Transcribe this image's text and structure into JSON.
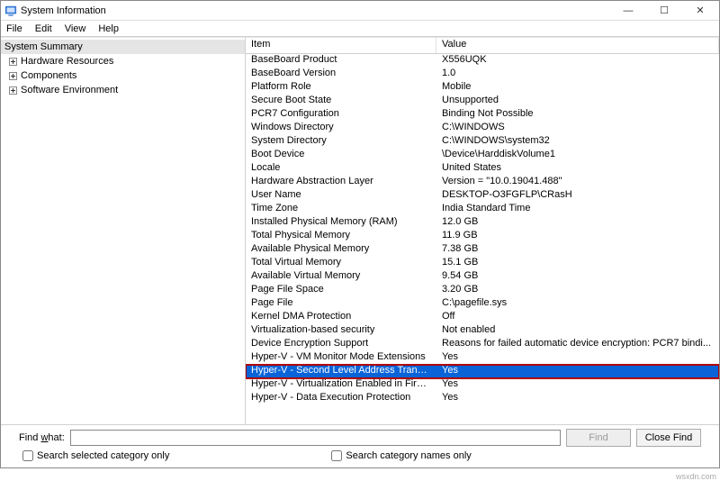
{
  "window": {
    "title": "System Information",
    "controls": {
      "minimize": "—",
      "maximize": "☐",
      "close": "✕"
    }
  },
  "menu": {
    "file": "File",
    "edit": "Edit",
    "view": "View",
    "help": "Help"
  },
  "tree": {
    "root": "System Summary",
    "children": [
      {
        "label": "Hardware Resources"
      },
      {
        "label": "Components"
      },
      {
        "label": "Software Environment"
      }
    ]
  },
  "grid": {
    "headers": {
      "item": "Item",
      "value": "Value"
    },
    "rows": [
      {
        "item": "BaseBoard Product",
        "value": "X556UQK"
      },
      {
        "item": "BaseBoard Version",
        "value": "1.0"
      },
      {
        "item": "Platform Role",
        "value": "Mobile"
      },
      {
        "item": "Secure Boot State",
        "value": "Unsupported"
      },
      {
        "item": "PCR7 Configuration",
        "value": "Binding Not Possible"
      },
      {
        "item": "Windows Directory",
        "value": "C:\\WINDOWS"
      },
      {
        "item": "System Directory",
        "value": "C:\\WINDOWS\\system32"
      },
      {
        "item": "Boot Device",
        "value": "\\Device\\HarddiskVolume1"
      },
      {
        "item": "Locale",
        "value": "United States"
      },
      {
        "item": "Hardware Abstraction Layer",
        "value": "Version = \"10.0.19041.488\""
      },
      {
        "item": "User Name",
        "value": "DESKTOP-O3FGFLP\\CRasH"
      },
      {
        "item": "Time Zone",
        "value": "India Standard Time"
      },
      {
        "item": "Installed Physical Memory (RAM)",
        "value": "12.0 GB"
      },
      {
        "item": "Total Physical Memory",
        "value": "11.9 GB"
      },
      {
        "item": "Available Physical Memory",
        "value": "7.38 GB"
      },
      {
        "item": "Total Virtual Memory",
        "value": "15.1 GB"
      },
      {
        "item": "Available Virtual Memory",
        "value": "9.54 GB"
      },
      {
        "item": "Page File Space",
        "value": "3.20 GB"
      },
      {
        "item": "Page File",
        "value": "C:\\pagefile.sys"
      },
      {
        "item": "Kernel DMA Protection",
        "value": "Off"
      },
      {
        "item": "Virtualization-based security",
        "value": "Not enabled"
      },
      {
        "item": "Device Encryption Support",
        "value": "Reasons for failed automatic device encryption: PCR7 bindi..."
      },
      {
        "item": "Hyper-V - VM Monitor Mode Extensions",
        "value": "Yes"
      },
      {
        "item": "Hyper-V - Second Level Address Translation ...",
        "value": "Yes",
        "selected": true
      },
      {
        "item": "Hyper-V - Virtualization Enabled in Firmware",
        "value": "Yes"
      },
      {
        "item": "Hyper-V - Data Execution Protection",
        "value": "Yes"
      }
    ]
  },
  "find": {
    "label_html": "Find what:",
    "label_prefix": "Find ",
    "label_under": "w",
    "label_suffix": "hat:",
    "input_value": "",
    "find_btn": "Find",
    "close_btn": "Close Find",
    "chk1": "Search selected category only",
    "chk2": "Search category names only"
  },
  "watermark": "wsxdn.com"
}
